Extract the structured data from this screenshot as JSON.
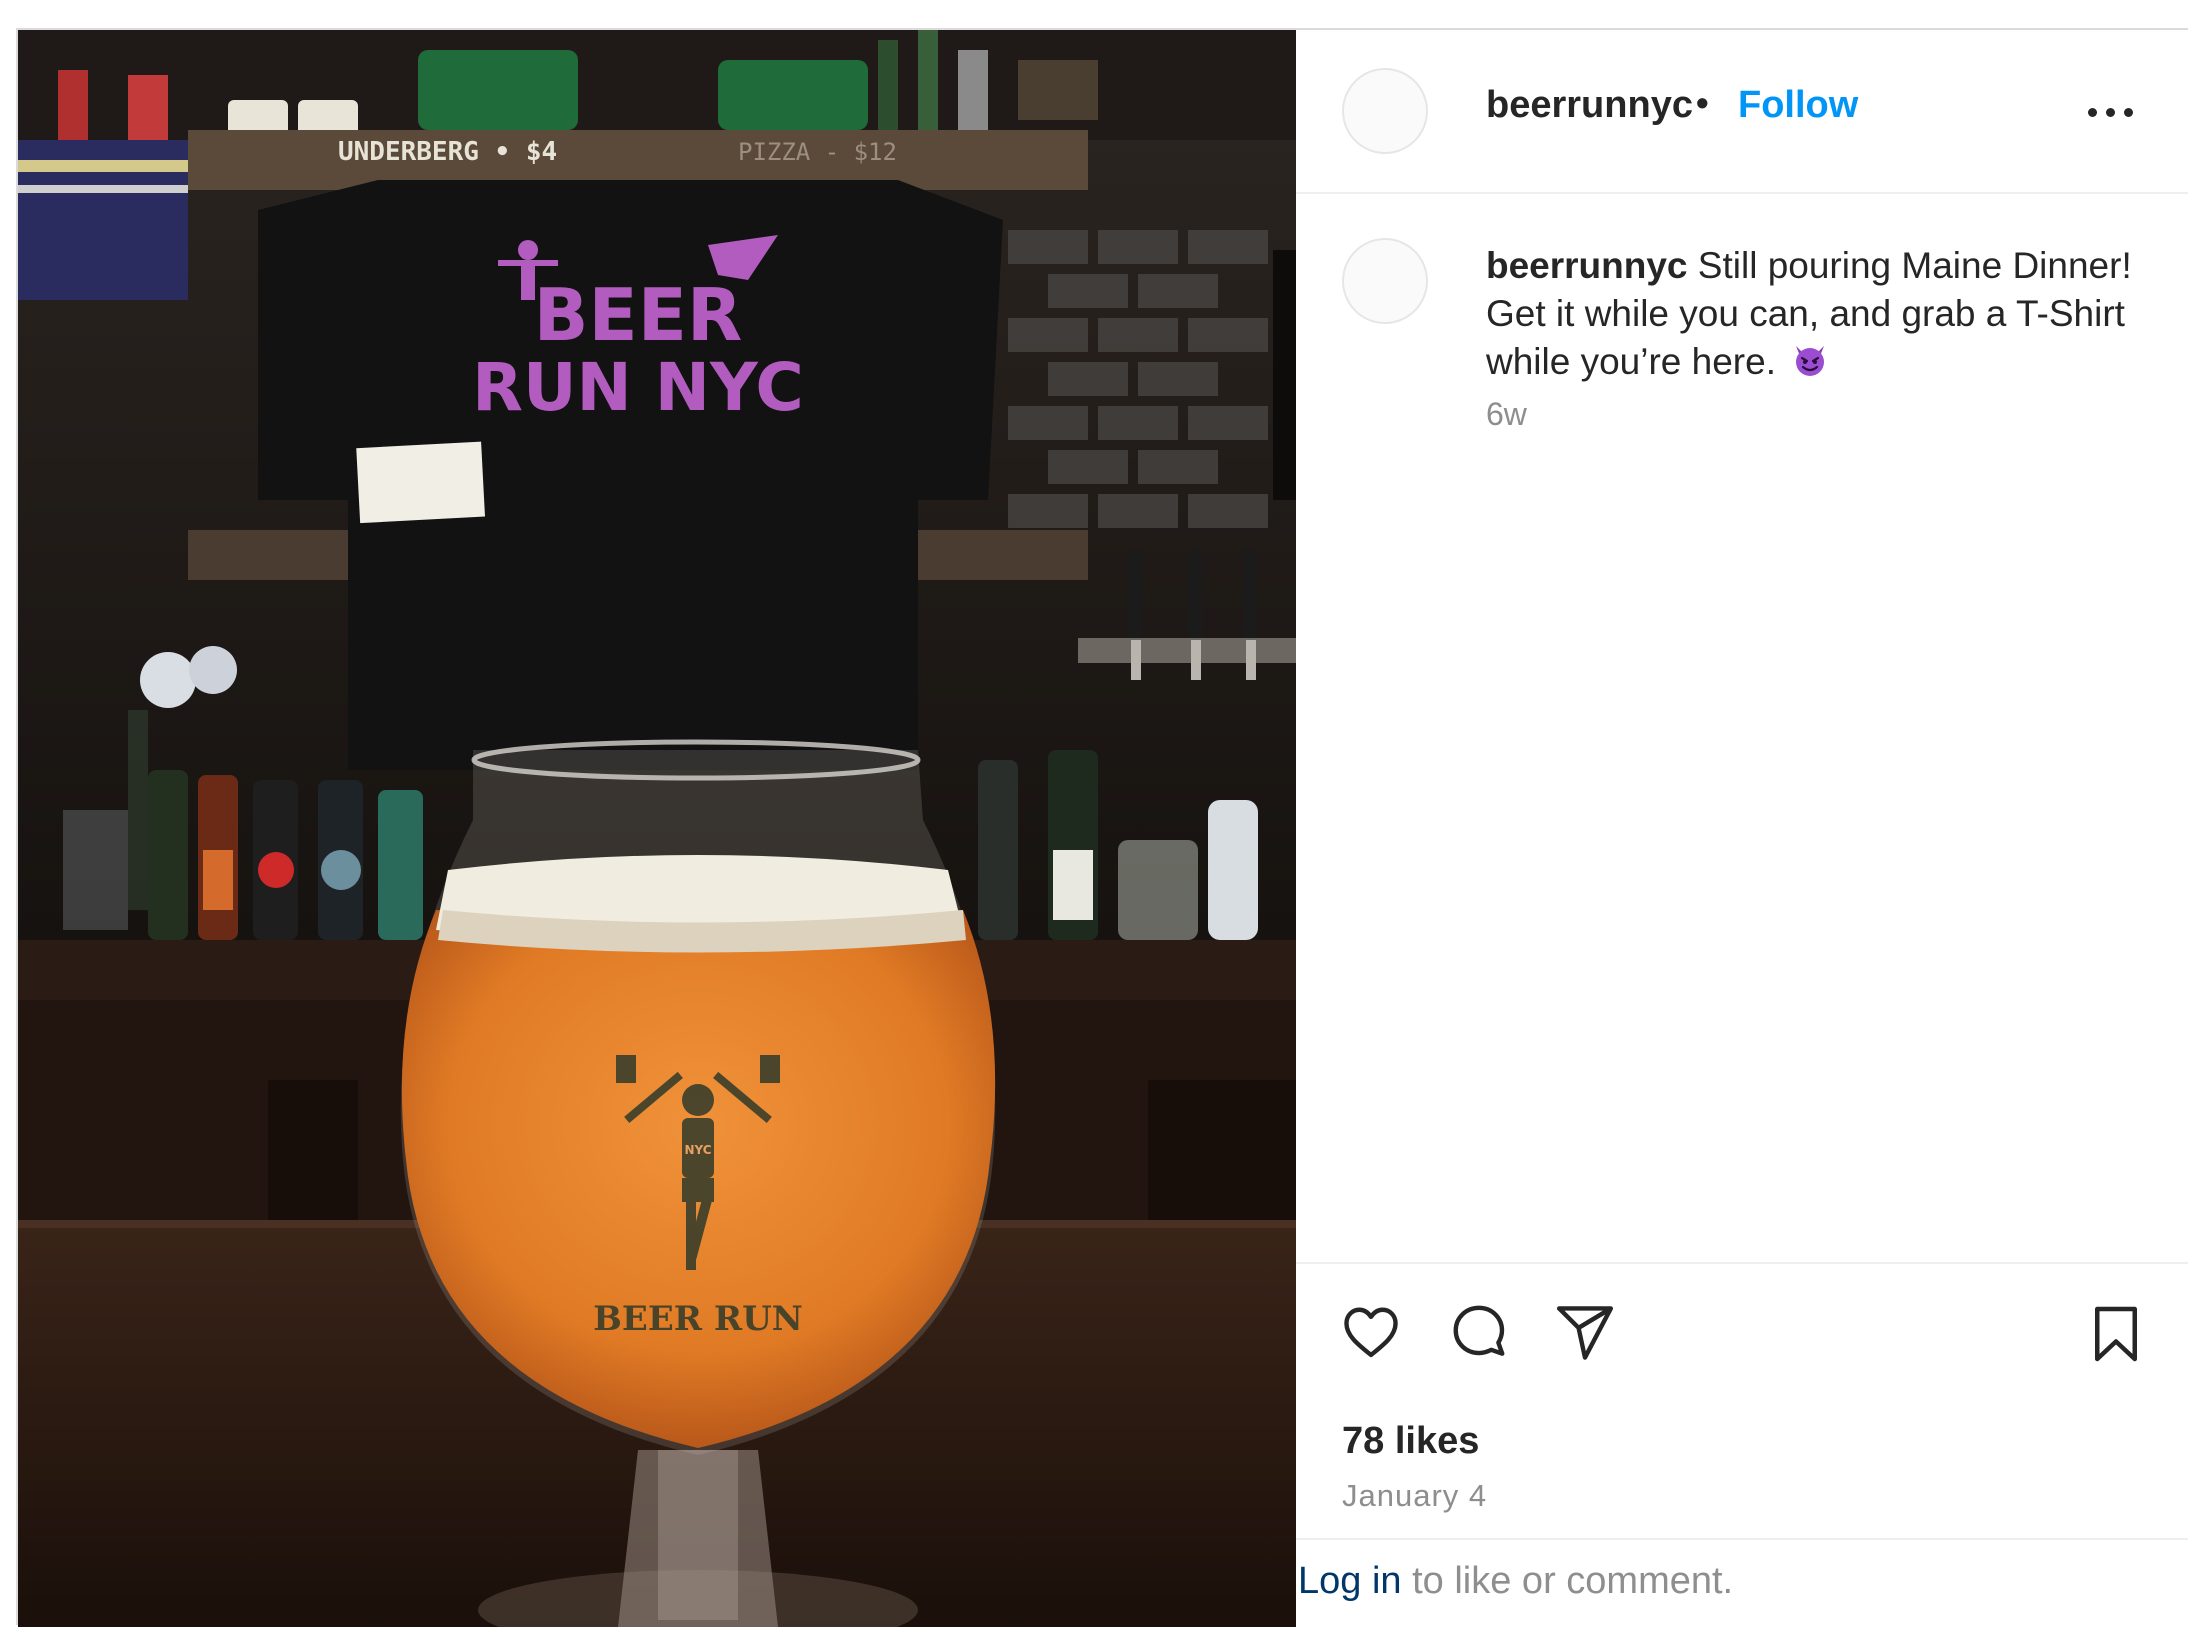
{
  "post": {
    "username": "beerrunnyc",
    "separator": "•",
    "follow_label": "Follow",
    "more_icon": "more-options-icon"
  },
  "photo": {
    "shelf_label_left": "UNDERBERG • $4",
    "shelf_label_right": "PIZZA - $12",
    "shirt_text_line1": "BEER",
    "shirt_text_line2": "RUN NYC",
    "glass_print": "BEER RUN",
    "glass_print_small": "NYC",
    "colors": {
      "beer": "#e07a25",
      "foam": "#f1ece0",
      "shirt_logo": "#b35cc0",
      "bar_wood": "#2a1a12"
    }
  },
  "caption": {
    "username": "beerrunnyc",
    "text": "Still pouring Maine Dinner! Get it while you can, and grab a T-Shirt while you’re here.",
    "emoji": "smiling-devil-emoji",
    "time_ago": "6w"
  },
  "actions": {
    "like_icon": "heart-icon",
    "comment_icon": "comment-icon",
    "share_icon": "share-icon",
    "save_icon": "bookmark-icon",
    "likes_text": "78 likes",
    "date_text": "January 4"
  },
  "footer": {
    "login_link": "Log in",
    "login_suffix": " to like or comment."
  }
}
